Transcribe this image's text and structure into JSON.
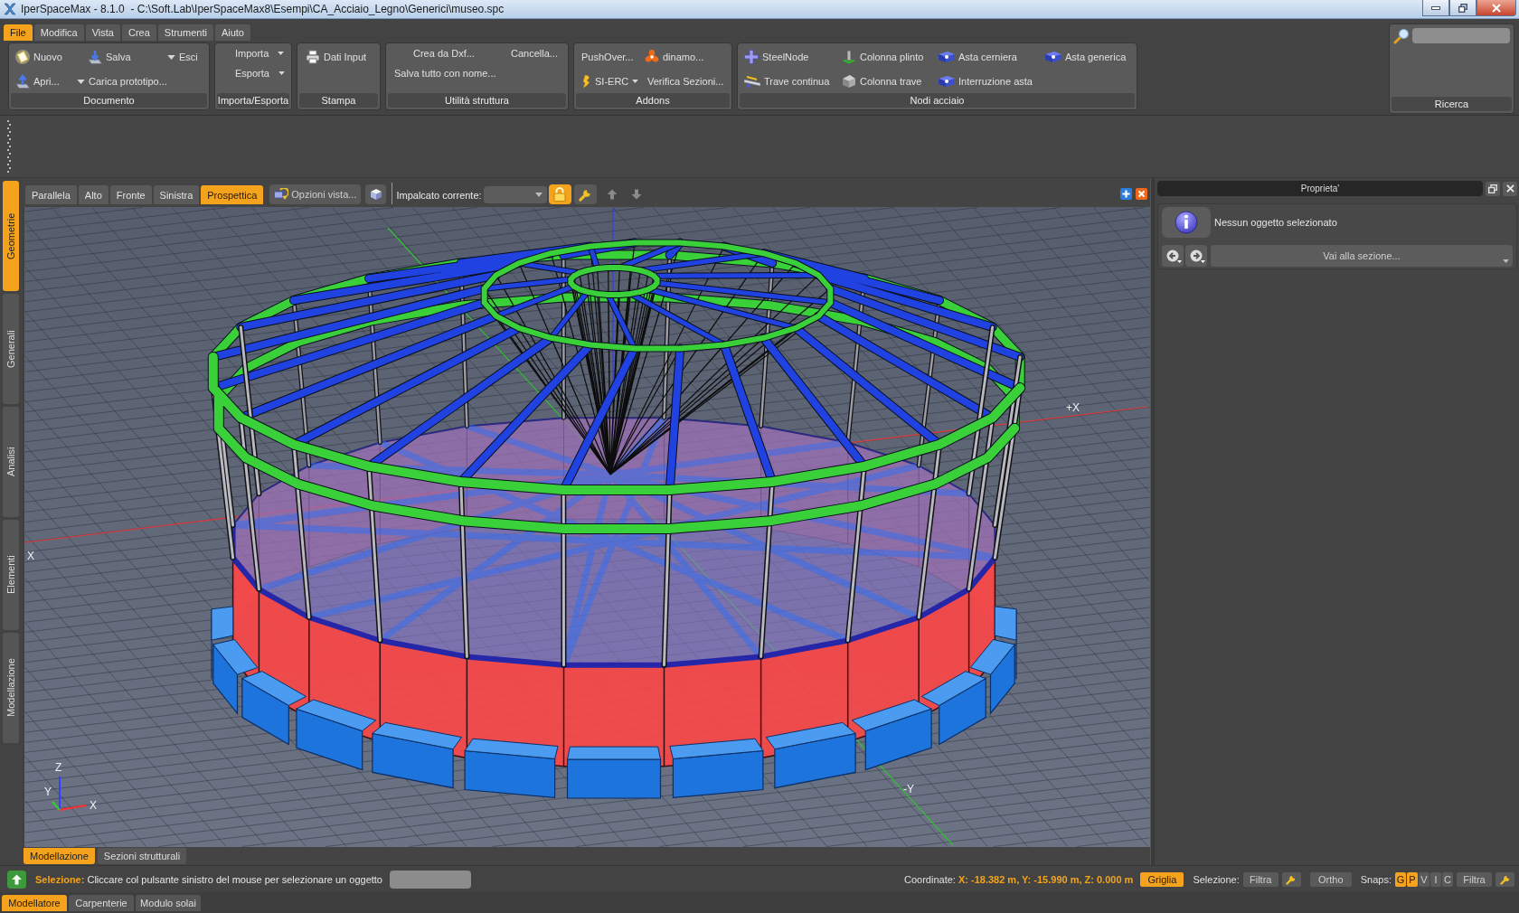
{
  "window": {
    "title": "IperSpaceMax - 8.1.0  - C:\\Soft.Lab\\IperSpaceMax8\\Esempi\\CA_Acciaio_Legno\\Generici\\museo.spc"
  },
  "menu": [
    {
      "label": "File",
      "selected": true
    },
    {
      "label": "Modifica",
      "selected": false
    },
    {
      "label": "Vista",
      "selected": false
    },
    {
      "label": "Crea",
      "selected": false
    },
    {
      "label": "Strumenti",
      "selected": false
    },
    {
      "label": "Aiuto",
      "selected": false
    }
  ],
  "ribbon": [
    {
      "title": "Documento",
      "items": [
        "Nuovo",
        "Salva",
        "Esci",
        "Apri...",
        "Carica prototipo..."
      ]
    },
    {
      "title": "Importa/Esporta",
      "items": [
        "Importa",
        "Esporta"
      ]
    },
    {
      "title": "Stampa",
      "items": [
        "Dati Input"
      ]
    },
    {
      "title": "Utilità struttura",
      "items": [
        "Crea da Dxf...",
        "Cancella...",
        "Salva tutto con nome..."
      ]
    },
    {
      "title": "Addons",
      "items": [
        "PushOver...",
        "dinamo...",
        "SI-ERC",
        "Verifica Sezioni..."
      ]
    },
    {
      "title": "Nodi acciaio",
      "items": [
        "SteelNode",
        "Colonna plinto",
        "Asta cerniera",
        "Asta generica",
        "Trave continua",
        "Colonna trave",
        "Interruzione asta"
      ]
    }
  ],
  "search": {
    "title": "Ricerca"
  },
  "side_tabs": [
    {
      "label": "Geometrie",
      "selected": true
    },
    {
      "label": "Generali",
      "selected": false
    },
    {
      "label": "Analisi",
      "selected": false
    },
    {
      "label": "Elementi",
      "selected": false
    },
    {
      "label": "Modellazione",
      "selected": false
    }
  ],
  "view_toolbar": {
    "tabs": [
      {
        "label": "Parallela",
        "selected": false
      },
      {
        "label": "Alto",
        "selected": false
      },
      {
        "label": "Fronte",
        "selected": false
      },
      {
        "label": "Sinistra",
        "selected": false
      },
      {
        "label": "Prospettica",
        "selected": true
      }
    ],
    "options_label": "Opzioni vista...",
    "floor_label": "Impalcato corrente:",
    "lock_active": true
  },
  "viewport": {
    "axis_labels": [
      "+X",
      "X",
      "-Y"
    ],
    "triad_labels": [
      "Z",
      "Y",
      "X"
    ]
  },
  "view_tabs": [
    {
      "label": "Modellazione",
      "selected": true
    },
    {
      "label": "Sezioni strutturali",
      "selected": false
    }
  ],
  "properties": {
    "title": "Proprieta'",
    "message": "Nessun oggetto selezionato",
    "goto_section": "Vai alla sezione..."
  },
  "status": {
    "message": "**Selezione:** Cliccare col pulsante sinistro del mouse per selezionare un oggetto",
    "coordinates": "Coordinate: **X: -18.382 m, Y: -15.990 m, Z: 0.000 m**",
    "grid": {
      "label": "Griglia",
      "on": true
    },
    "selection_label": "Selezione:",
    "selection_filter": "Filtra",
    "ortho": {
      "label": "Ortho",
      "on": false
    },
    "snaps_label": "Snaps:",
    "snaps": [
      {
        "label": "G",
        "on": true
      },
      {
        "label": "P",
        "on": true
      },
      {
        "label": "V",
        "on": false
      },
      {
        "label": "I",
        "on": false
      },
      {
        "label": "C",
        "on": false
      }
    ],
    "snaps_filter": "Filtra"
  },
  "modules": [
    {
      "label": "Modellatore",
      "selected": true
    },
    {
      "label": "Carpenterie",
      "selected": false
    },
    {
      "label": "Modulo solai",
      "selected": false
    }
  ]
}
